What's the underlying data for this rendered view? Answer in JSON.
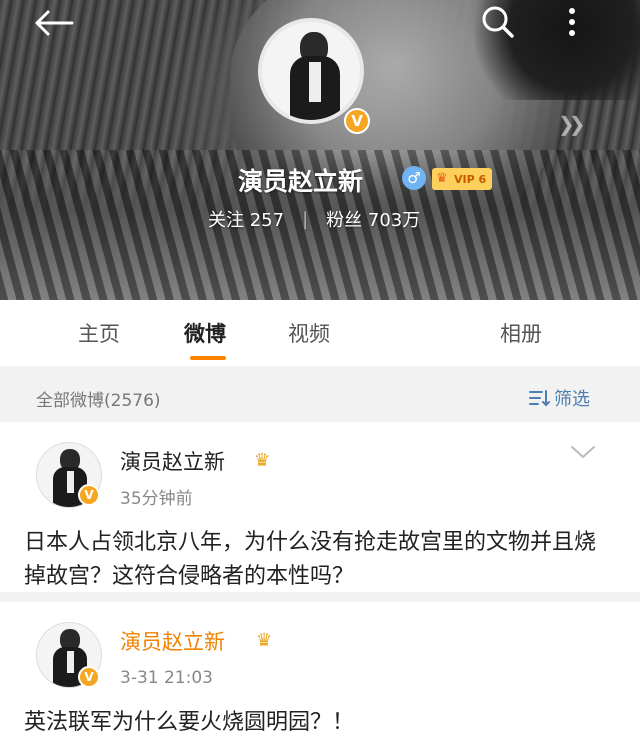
{
  "profile": {
    "name": "演员赵立新",
    "vip_label": "VIP 6",
    "following_label": "关注",
    "following_count": "257",
    "followers_label": "粉丝",
    "followers_count": "703万"
  },
  "tabs": [
    {
      "label": "主页",
      "active": false
    },
    {
      "label": "微博",
      "active": true
    },
    {
      "label": "视频",
      "active": false
    },
    {
      "label": "相册",
      "active": false
    }
  ],
  "filter": {
    "count_label": "全部微博(2576)",
    "filter_label": "筛选"
  },
  "posts": [
    {
      "author": "演员赵立新",
      "time": "35分钟前",
      "text": "日本人占领北京八年，为什么没有抢走故宫里的文物并且烧掉故宫？这符合侵略者的本性吗？"
    },
    {
      "author": "演员赵立新",
      "time": "3-31 21:03",
      "text": "英法联军为什么要火烧圆明园？！"
    }
  ],
  "icons": {
    "back": "arrow-left-icon",
    "search": "search-icon",
    "more": "more-vertical-icon",
    "verified": "v-badge-icon",
    "gender": "male-icon",
    "crown": "crown-icon",
    "filter": "filter-icon",
    "expand": "chevron-down-icon"
  },
  "colors": {
    "accent": "#ff8200",
    "link": "#4e7fb3",
    "verified": "#f5a623",
    "vip_name": "#f08300"
  }
}
